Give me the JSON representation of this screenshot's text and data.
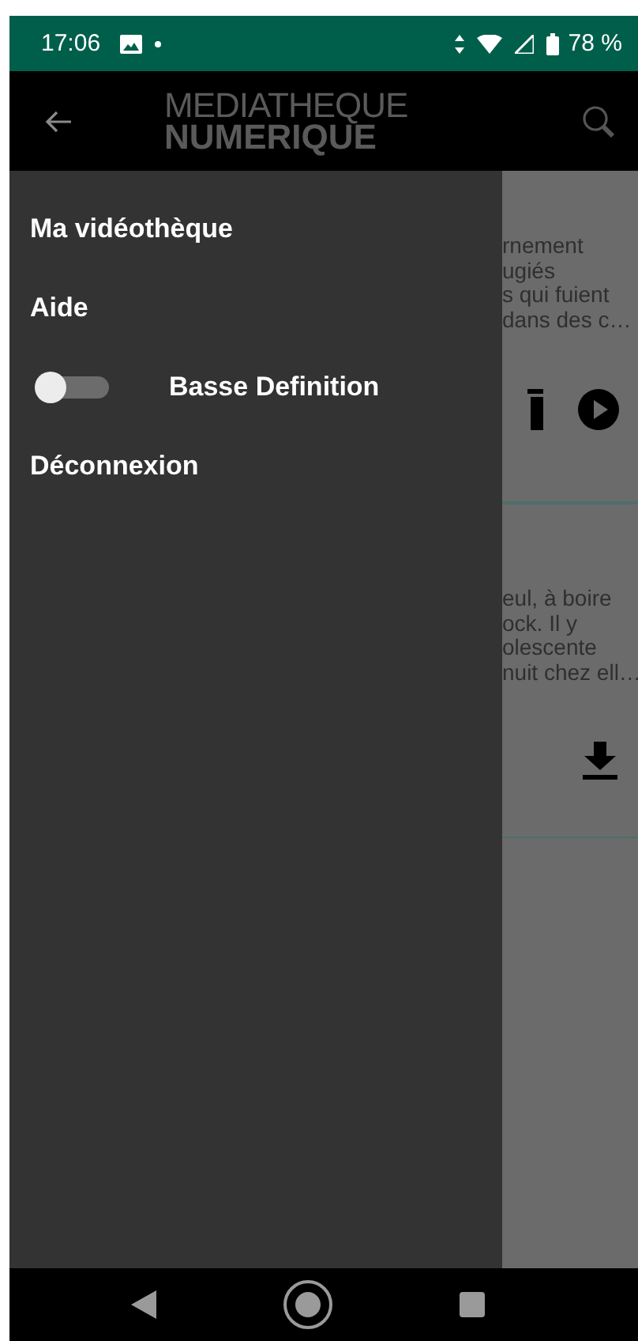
{
  "status_bar": {
    "time": "17:06",
    "battery": "78 %"
  },
  "app_bar": {
    "title_line_1": "MEDIATHEQUE",
    "title_line_2": "NUMERIQUE"
  },
  "drawer": {
    "items": [
      {
        "kind": "link",
        "label": "Ma vidéothèque"
      },
      {
        "kind": "link",
        "label": "Aide"
      },
      {
        "kind": "switch",
        "label": "Basse Definition",
        "on": false
      },
      {
        "kind": "link",
        "label": "Déconnexion"
      }
    ]
  },
  "background_cards": [
    {
      "lines": [
        "rnement",
        "ugiés",
        "s qui fuient",
        "dans des c…"
      ],
      "kind": "play"
    },
    {
      "lines": [
        "eul, à boire",
        "ock. Il y",
        "olescente",
        "nuit chez ell…"
      ],
      "kind": "download"
    }
  ]
}
